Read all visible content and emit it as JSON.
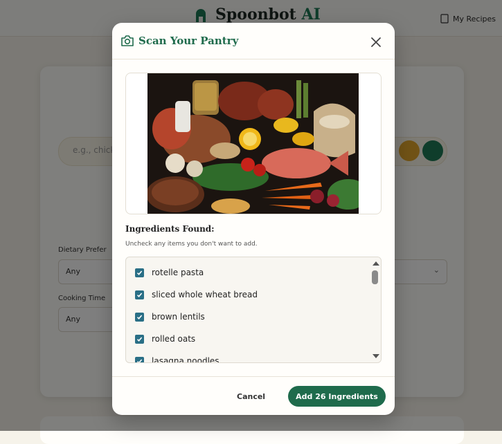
{
  "app": {
    "brand_main": "Spoonbot",
    "brand_accent": "AI",
    "my_recipes": "My Recipes",
    "search_placeholder": "e.g., chicken",
    "dietary_label": "Dietary Prefer",
    "dietary_value": "Any",
    "cooking_label": "Cooking Time",
    "cooking_value": "Any"
  },
  "modal": {
    "title": "Scan Your Pantry",
    "ingredients_title": "Ingredients Found:",
    "ingredients_subtitle": "Uncheck any items you don't want to add.",
    "items": [
      {
        "label": "rotelle pasta",
        "checked": true
      },
      {
        "label": "sliced whole wheat bread",
        "checked": true
      },
      {
        "label": "brown lentils",
        "checked": true
      },
      {
        "label": "rolled oats",
        "checked": true
      },
      {
        "label": "lasagna noodles",
        "checked": true
      }
    ],
    "cancel_label": "Cancel",
    "add_label": "Add 26 Ingredients"
  },
  "colors": {
    "brand_green": "#1f6b4c",
    "checkbox": "#2a6f86",
    "accent_orange": "#e3a72d"
  }
}
